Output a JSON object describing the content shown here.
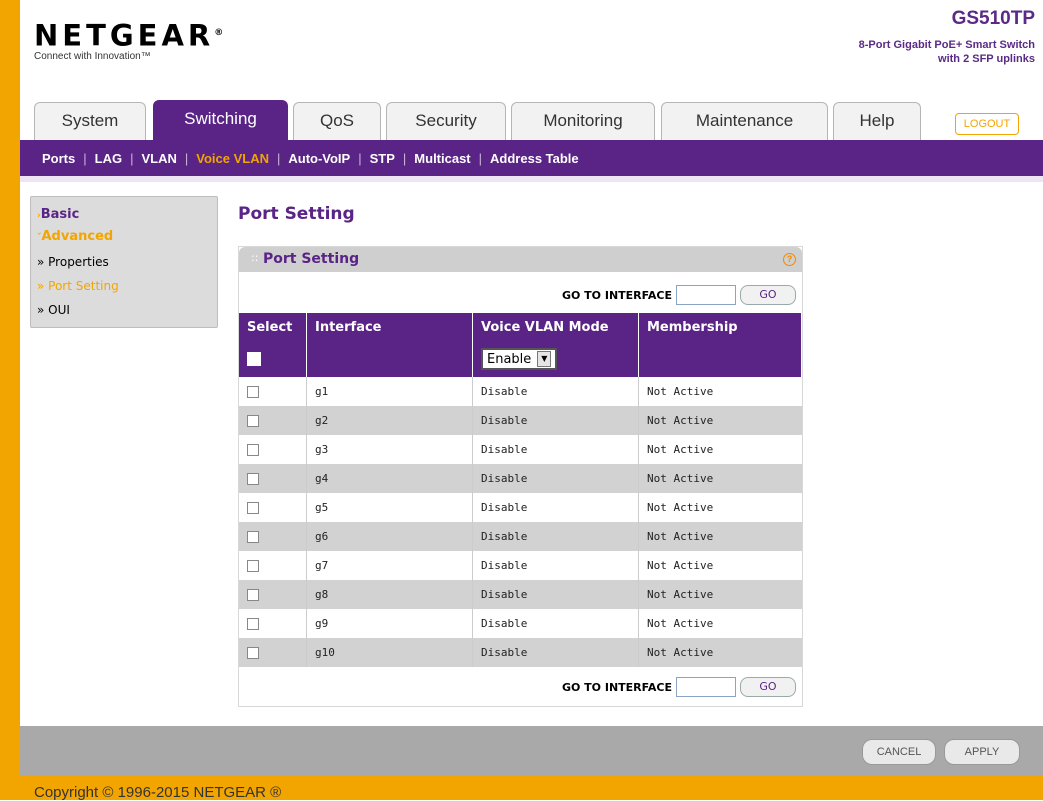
{
  "header": {
    "logo": "NETGEAR",
    "logo_mark": "®",
    "tagline": "Connect with Innovation™",
    "model": "GS510TP",
    "model_desc_line1": "8-Port Gigabit PoE+ Smart Switch",
    "model_desc_line2": "with 2 SFP uplinks"
  },
  "tabs": [
    {
      "label": "System"
    },
    {
      "label": "Switching"
    },
    {
      "label": "QoS"
    },
    {
      "label": "Security"
    },
    {
      "label": "Monitoring"
    },
    {
      "label": "Maintenance"
    },
    {
      "label": "Help"
    }
  ],
  "logout_label": "LOGOUT",
  "subnav": [
    "Ports",
    "LAG",
    "VLAN",
    "Voice VLAN",
    "Auto-VoIP",
    "STP",
    "Multicast",
    "Address Table"
  ],
  "sidebar": {
    "basic": "Basic",
    "advanced": "Advanced",
    "items": [
      "» Properties",
      "» Port Setting",
      "» OUI"
    ]
  },
  "page_title": "Port Setting",
  "panel": {
    "title": "Port Setting",
    "help": "?",
    "goto_label": "GO TO INTERFACE",
    "go_button": "GO",
    "columns": [
      "Select",
      "Interface",
      "Voice VLAN Mode",
      "Membership"
    ],
    "filter_mode": "Enable",
    "rows": [
      {
        "interface": "g1",
        "mode": "Disable",
        "membership": "Not Active"
      },
      {
        "interface": "g2",
        "mode": "Disable",
        "membership": "Not Active"
      },
      {
        "interface": "g3",
        "mode": "Disable",
        "membership": "Not Active"
      },
      {
        "interface": "g4",
        "mode": "Disable",
        "membership": "Not Active"
      },
      {
        "interface": "g5",
        "mode": "Disable",
        "membership": "Not Active"
      },
      {
        "interface": "g6",
        "mode": "Disable",
        "membership": "Not Active"
      },
      {
        "interface": "g7",
        "mode": "Disable",
        "membership": "Not Active"
      },
      {
        "interface": "g8",
        "mode": "Disable",
        "membership": "Not Active"
      },
      {
        "interface": "g9",
        "mode": "Disable",
        "membership": "Not Active"
      },
      {
        "interface": "g10",
        "mode": "Disable",
        "membership": "Not Active"
      }
    ]
  },
  "footer": {
    "cancel": "CANCEL",
    "apply": "APPLY",
    "copyright": "Copyright © 1996-2015 NETGEAR ®"
  }
}
